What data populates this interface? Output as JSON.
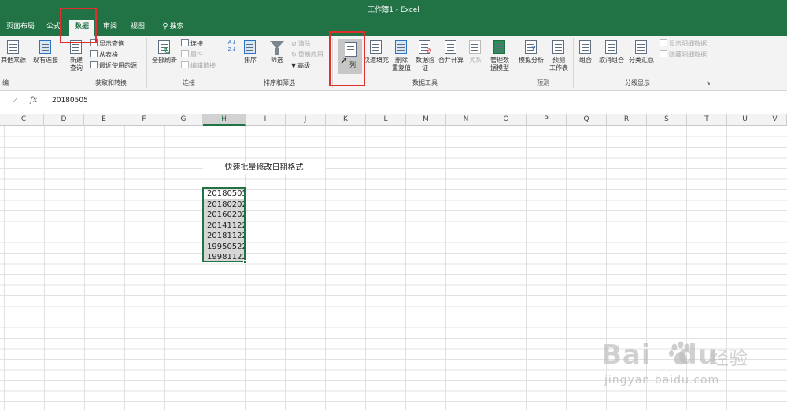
{
  "window": {
    "title": "工作簿1  -  Excel"
  },
  "tabs": [
    {
      "label": "页面布局"
    },
    {
      "label": "公式"
    },
    {
      "label": "数据"
    },
    {
      "label": "审阅"
    },
    {
      "label": "视图"
    },
    {
      "label": "搜索"
    }
  ],
  "ribbon": {
    "get_data": {
      "other_sources": "其他来源",
      "existing": "现有连接",
      "new_query": "新建",
      "new_query2": "查询",
      "show_query": "显示查询",
      "from_table": "从表格",
      "recent_sources": "最近使用的源",
      "group_label": "获取和转换",
      "left_group_label": "编"
    },
    "connections": {
      "refresh_all": "全部刷新",
      "connections": "连接",
      "properties": "属性",
      "edit_links": "编辑链接",
      "group_label": "连接"
    },
    "sort_filter": {
      "sort": "排序",
      "filter": "筛选",
      "clear": "清除",
      "reapply": "重新应用",
      "advanced": "高级",
      "group_label": "排序和筛选"
    },
    "data_tools": {
      "text_to_columns": "列",
      "flash_fill": "快速填充",
      "remove_dup": "删除",
      "remove_dup2": "重复值",
      "validation": "数据验",
      "validation2": "证",
      "consolidate": "合并计算",
      "relationships": "关系",
      "data_model": "管理数",
      "data_model2": "据模型",
      "group_label": "数据工具"
    },
    "forecast": {
      "what_if": "模拟分析",
      "forecast_sheet": "预测",
      "forecast_sheet2": "工作表",
      "group_label": "预测"
    },
    "outline": {
      "group": "组合",
      "ungroup": "取消组合",
      "subtotal": "分类汇总",
      "show_detail": "显示明细数据",
      "hide_detail": "隐藏明细数据",
      "group_label": "分级显示"
    }
  },
  "formula_bar": {
    "fx": "fx",
    "content": "20180505"
  },
  "columns": [
    "C",
    "D",
    "E",
    "F",
    "G",
    "H",
    "I",
    "J",
    "K",
    "L",
    "M",
    "N",
    "O",
    "P",
    "Q",
    "R",
    "S",
    "T",
    "U",
    "V"
  ],
  "sheet": {
    "title": "快速批量修改日期格式",
    "dates": [
      "20180505",
      "20180202",
      "20160202",
      "20141122",
      "20181122",
      "19950522",
      "19981122"
    ]
  },
  "watermark": {
    "logo": "Bai",
    "logo2": "du",
    "cn": "经验",
    "sub": "jingyan.baidu.com"
  },
  "colors": {
    "accent": "#217346",
    "highlight": "#e0302e"
  }
}
